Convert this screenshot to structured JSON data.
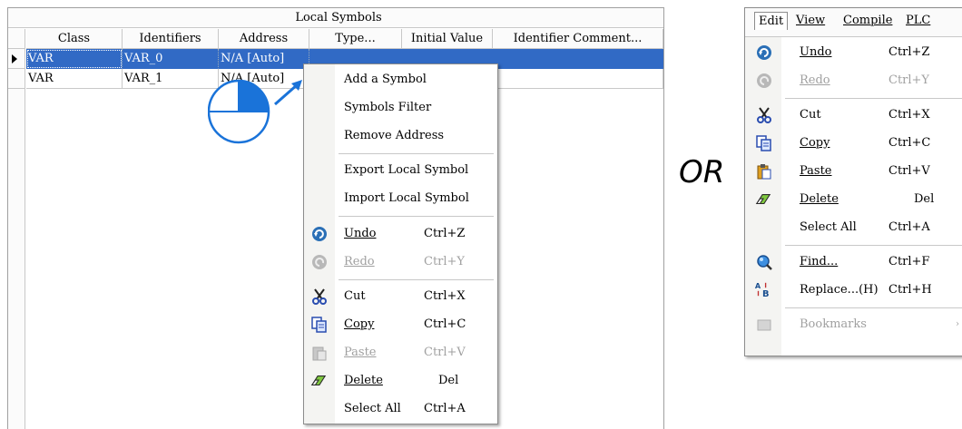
{
  "table": {
    "title": "Local Symbols",
    "columns": [
      "Class",
      "Identifiers",
      "Address",
      "Type...",
      "Initial Value",
      "Identifier Comment..."
    ],
    "rows": [
      {
        "class": "VAR",
        "identifier": "VAR_0",
        "address": "N/A [Auto]",
        "type": "",
        "initial": "",
        "comment": ""
      },
      {
        "class": "VAR",
        "identifier": "VAR_1",
        "address": "N/A [Auto]",
        "type": "",
        "initial": "",
        "comment": ""
      }
    ]
  },
  "context_menu": {
    "items": [
      {
        "label": "Add a Symbol"
      },
      {
        "label": "Symbols Filter"
      },
      {
        "label": "Remove Address"
      },
      {
        "label": "Export Local Symbol"
      },
      {
        "label": "Import Local Symbol"
      },
      {
        "label": "Undo",
        "accel": "Ctrl+Z",
        "icon": "undo-icon"
      },
      {
        "label": "Redo",
        "accel": "Ctrl+Y",
        "icon": "redo-icon",
        "disabled": true
      },
      {
        "label": "Cut",
        "accel": "Ctrl+X",
        "icon": "cut-icon"
      },
      {
        "label": "Copy",
        "accel": "Ctrl+C",
        "icon": "copy-icon"
      },
      {
        "label": "Paste",
        "accel": "Ctrl+V",
        "icon": "paste-icon",
        "disabled": true
      },
      {
        "label": "Delete",
        "accel": "Del",
        "icon": "eraser-icon"
      },
      {
        "label": "Select All",
        "accel": "Ctrl+A"
      }
    ]
  },
  "or_text": "OR",
  "menubar": {
    "items": [
      "Edit",
      "View",
      "Compile",
      "PLC"
    ]
  },
  "edit_menu": {
    "items": [
      {
        "label": "Undo",
        "accel": "Ctrl+Z",
        "icon": "undo-icon"
      },
      {
        "label": "Redo",
        "accel": "Ctrl+Y",
        "icon": "redo-icon",
        "disabled": true
      },
      {
        "label": "Cut",
        "accel": "Ctrl+X",
        "icon": "cut-icon"
      },
      {
        "label": "Copy",
        "accel": "Ctrl+C",
        "icon": "copy-icon"
      },
      {
        "label": "Paste",
        "accel": "Ctrl+V",
        "icon": "paste-icon"
      },
      {
        "label": "Delete",
        "accel": "Del",
        "icon": "eraser-icon"
      },
      {
        "label": "Select All",
        "accel": "Ctrl+A"
      },
      {
        "label": "Find...",
        "accel": "Ctrl+F",
        "icon": "find-icon"
      },
      {
        "label": "Replace...(H)",
        "accel": "Ctrl+H",
        "icon": "replace-icon"
      },
      {
        "label": "Bookmarks",
        "icon": "bookmark-icon",
        "disabled": true
      }
    ]
  },
  "colors": {
    "selection": "#316ac5",
    "mouse_blue": "#1a73d9"
  }
}
